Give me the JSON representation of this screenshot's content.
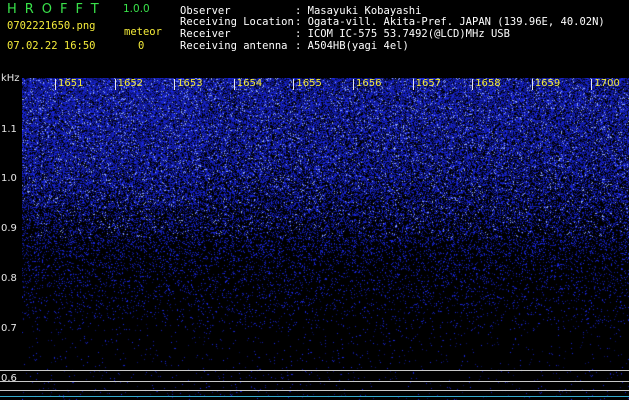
{
  "header": {
    "app_name": "HROFFT",
    "version": "1.0.0",
    "filename": "0702221650.png",
    "timestamp": "07.02.22 16:50",
    "meteor_label": "meteor",
    "meteor_count": "0",
    "fields": [
      {
        "label": "Observer",
        "value": ": Masayuki Kobayashi"
      },
      {
        "label": "Receiving Location",
        "value": ": Ogata-vill. Akita-Pref. JAPAN (139.96E, 40.02N)"
      },
      {
        "label": "Receiver",
        "value": ": ICOM IC-575 53.7492(@LCD)MHz USB"
      },
      {
        "label": "Receiving antenna",
        "value": ": A504HB(yagi 4el)"
      }
    ]
  },
  "spectrogram": {
    "unit_label": "kHz",
    "time_labels": [
      "1651",
      "1652",
      "1653",
      "1654",
      "1655",
      "1656",
      "1657",
      "1658",
      "1659",
      "1700"
    ],
    "freq_labels": [
      "1.1",
      "1.0",
      "0.9",
      "0.8",
      "0.7",
      "0.6"
    ],
    "colors": {
      "signal_dense": "#3c46ff",
      "signal_bright": "#a0b4ff",
      "header_yellow": "#f5ec3a",
      "title_green": "#39e24a",
      "marker_line": "#c8c8c8",
      "cyan_line": "#33aacc"
    }
  }
}
